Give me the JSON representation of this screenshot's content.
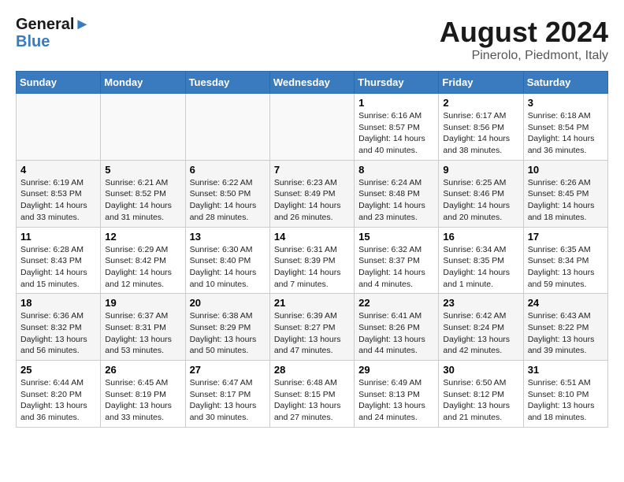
{
  "header": {
    "logo_general": "General",
    "logo_blue": "Blue",
    "month_title": "August 2024",
    "location": "Pinerolo, Piedmont, Italy"
  },
  "days_of_week": [
    "Sunday",
    "Monday",
    "Tuesday",
    "Wednesday",
    "Thursday",
    "Friday",
    "Saturday"
  ],
  "weeks": [
    [
      {
        "day": "",
        "empty": true
      },
      {
        "day": "",
        "empty": true
      },
      {
        "day": "",
        "empty": true
      },
      {
        "day": "",
        "empty": true
      },
      {
        "day": "1",
        "sunrise": "6:16 AM",
        "sunset": "8:57 PM",
        "daylight": "14 hours and 40 minutes."
      },
      {
        "day": "2",
        "sunrise": "6:17 AM",
        "sunset": "8:56 PM",
        "daylight": "14 hours and 38 minutes."
      },
      {
        "day": "3",
        "sunrise": "6:18 AM",
        "sunset": "8:54 PM",
        "daylight": "14 hours and 36 minutes."
      }
    ],
    [
      {
        "day": "4",
        "sunrise": "6:19 AM",
        "sunset": "8:53 PM",
        "daylight": "14 hours and 33 minutes."
      },
      {
        "day": "5",
        "sunrise": "6:21 AM",
        "sunset": "8:52 PM",
        "daylight": "14 hours and 31 minutes."
      },
      {
        "day": "6",
        "sunrise": "6:22 AM",
        "sunset": "8:50 PM",
        "daylight": "14 hours and 28 minutes."
      },
      {
        "day": "7",
        "sunrise": "6:23 AM",
        "sunset": "8:49 PM",
        "daylight": "14 hours and 26 minutes."
      },
      {
        "day": "8",
        "sunrise": "6:24 AM",
        "sunset": "8:48 PM",
        "daylight": "14 hours and 23 minutes."
      },
      {
        "day": "9",
        "sunrise": "6:25 AM",
        "sunset": "8:46 PM",
        "daylight": "14 hours and 20 minutes."
      },
      {
        "day": "10",
        "sunrise": "6:26 AM",
        "sunset": "8:45 PM",
        "daylight": "14 hours and 18 minutes."
      }
    ],
    [
      {
        "day": "11",
        "sunrise": "6:28 AM",
        "sunset": "8:43 PM",
        "daylight": "14 hours and 15 minutes."
      },
      {
        "day": "12",
        "sunrise": "6:29 AM",
        "sunset": "8:42 PM",
        "daylight": "14 hours and 12 minutes."
      },
      {
        "day": "13",
        "sunrise": "6:30 AM",
        "sunset": "8:40 PM",
        "daylight": "14 hours and 10 minutes."
      },
      {
        "day": "14",
        "sunrise": "6:31 AM",
        "sunset": "8:39 PM",
        "daylight": "14 hours and 7 minutes."
      },
      {
        "day": "15",
        "sunrise": "6:32 AM",
        "sunset": "8:37 PM",
        "daylight": "14 hours and 4 minutes."
      },
      {
        "day": "16",
        "sunrise": "6:34 AM",
        "sunset": "8:35 PM",
        "daylight": "14 hours and 1 minute."
      },
      {
        "day": "17",
        "sunrise": "6:35 AM",
        "sunset": "8:34 PM",
        "daylight": "13 hours and 59 minutes."
      }
    ],
    [
      {
        "day": "18",
        "sunrise": "6:36 AM",
        "sunset": "8:32 PM",
        "daylight": "13 hours and 56 minutes."
      },
      {
        "day": "19",
        "sunrise": "6:37 AM",
        "sunset": "8:31 PM",
        "daylight": "13 hours and 53 minutes."
      },
      {
        "day": "20",
        "sunrise": "6:38 AM",
        "sunset": "8:29 PM",
        "daylight": "13 hours and 50 minutes."
      },
      {
        "day": "21",
        "sunrise": "6:39 AM",
        "sunset": "8:27 PM",
        "daylight": "13 hours and 47 minutes."
      },
      {
        "day": "22",
        "sunrise": "6:41 AM",
        "sunset": "8:26 PM",
        "daylight": "13 hours and 44 minutes."
      },
      {
        "day": "23",
        "sunrise": "6:42 AM",
        "sunset": "8:24 PM",
        "daylight": "13 hours and 42 minutes."
      },
      {
        "day": "24",
        "sunrise": "6:43 AM",
        "sunset": "8:22 PM",
        "daylight": "13 hours and 39 minutes."
      }
    ],
    [
      {
        "day": "25",
        "sunrise": "6:44 AM",
        "sunset": "8:20 PM",
        "daylight": "13 hours and 36 minutes."
      },
      {
        "day": "26",
        "sunrise": "6:45 AM",
        "sunset": "8:19 PM",
        "daylight": "13 hours and 33 minutes."
      },
      {
        "day": "27",
        "sunrise": "6:47 AM",
        "sunset": "8:17 PM",
        "daylight": "13 hours and 30 minutes."
      },
      {
        "day": "28",
        "sunrise": "6:48 AM",
        "sunset": "8:15 PM",
        "daylight": "13 hours and 27 minutes."
      },
      {
        "day": "29",
        "sunrise": "6:49 AM",
        "sunset": "8:13 PM",
        "daylight": "13 hours and 24 minutes."
      },
      {
        "day": "30",
        "sunrise": "6:50 AM",
        "sunset": "8:12 PM",
        "daylight": "13 hours and 21 minutes."
      },
      {
        "day": "31",
        "sunrise": "6:51 AM",
        "sunset": "8:10 PM",
        "daylight": "13 hours and 18 minutes."
      }
    ]
  ],
  "labels": {
    "sunrise_prefix": "Sunrise: ",
    "sunset_prefix": "Sunset: ",
    "daylight_prefix": "Daylight: "
  }
}
